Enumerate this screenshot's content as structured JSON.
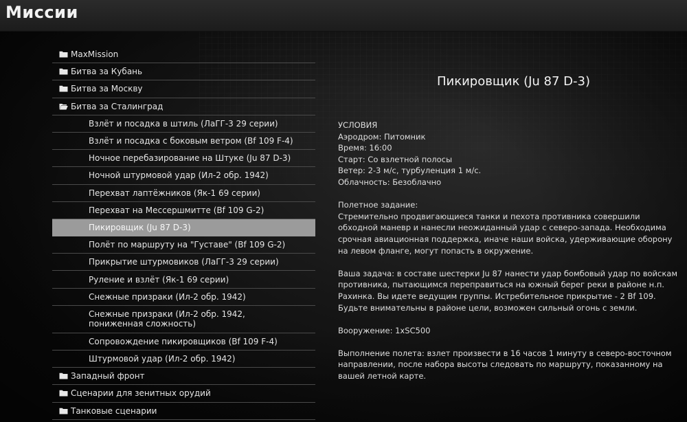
{
  "header": {
    "title": "Миссии"
  },
  "tree": {
    "folders_top": [
      {
        "label": "MaxMission",
        "open": false
      },
      {
        "label": "Битва за Кубань",
        "open": false
      },
      {
        "label": "Битва за Москву",
        "open": false
      },
      {
        "label": "Битва за Сталинград",
        "open": true
      }
    ],
    "missions": [
      {
        "label": "Взлёт и посадка в штиль (ЛаГГ-3 29 серии)",
        "selected": false
      },
      {
        "label": "Взлёт и посадка с боковым ветром (Bf 109 F-4)",
        "selected": false
      },
      {
        "label": "Ночное перебазирование на Штуке (Ju 87 D-3)",
        "selected": false
      },
      {
        "label": "Ночной штурмовой удар (Ил-2 обр. 1942)",
        "selected": false
      },
      {
        "label": "Перехват лаптёжников (Як-1 69 серии)",
        "selected": false
      },
      {
        "label": "Перехват на Мессершмитте (Bf 109 G-2)",
        "selected": false
      },
      {
        "label": "Пикировщик (Ju 87 D-3)",
        "selected": true
      },
      {
        "label": "Полёт по маршруту на \"Густаве\" (Bf 109 G-2)",
        "selected": false
      },
      {
        "label": "Прикрытие штурмовиков (ЛаГГ-3 29 серии)",
        "selected": false
      },
      {
        "label": "Руление и взлёт (Як-1 69 серии)",
        "selected": false
      },
      {
        "label": "Снежные призраки (Ил-2 обр. 1942)",
        "selected": false
      },
      {
        "label": "Снежные призраки (Ил-2 обр. 1942, пониженная сложность)",
        "selected": false
      },
      {
        "label": "Сопровождение пикировщиков (Bf 109 F-4)",
        "selected": false
      },
      {
        "label": "Штурмовой удар (Ил-2 обр. 1942)",
        "selected": false
      }
    ],
    "folders_bottom": [
      {
        "label": "Западный фронт",
        "open": false
      },
      {
        "label": "Сценарии для зенитных орудий",
        "open": false
      },
      {
        "label": "Танковые сценарии",
        "open": false
      }
    ]
  },
  "detail": {
    "title": "Пикировщик (Ju 87 D-3)",
    "conditions": [
      "УСЛОВИЯ",
      "Аэродром: Питомник",
      "Время: 16:00",
      "Старт: Со взлетной полосы",
      "Ветер: 2-3 м/с, турбуленция 1 м/с.",
      "Облачность: Безоблачно"
    ],
    "paragraphs": [
      "Полетное задание:\nСтремительно продвигающиеся танки и пехота противника совершили обходной маневр и нанесли неожиданный удар с северо-запада. Необходима срочная авиационная поддержка, иначе наши войска, удерживающие оборону на левом фланге, могут попасть в окружение.",
      "Ваша задача: в составе шестерки Ju 87 нанести удар бомбовый удар по войскам противника, пытающимся переправиться на южный берег реки в районе н.п. Рахинка. Вы идете ведущим группы. Истребительное прикрытие - 2 Bf 109. Будьте внимательны в районе цели, возможен сильный огонь с земли.",
      "Вооружение: 1xSC500",
      "Выполнение полета: взлет произвести в 16 часов 1 минуту в северо-восточном направлении, после набора высоты следовать по маршруту, показанному на вашей летной карте."
    ]
  },
  "colors": {
    "selected_row": "#9b9b9b",
    "row_divider": "#4a4a4a",
    "title_bar": "#242424"
  },
  "icons": {
    "folder_closed": "folder-icon",
    "folder_open": "folder-open-icon"
  }
}
